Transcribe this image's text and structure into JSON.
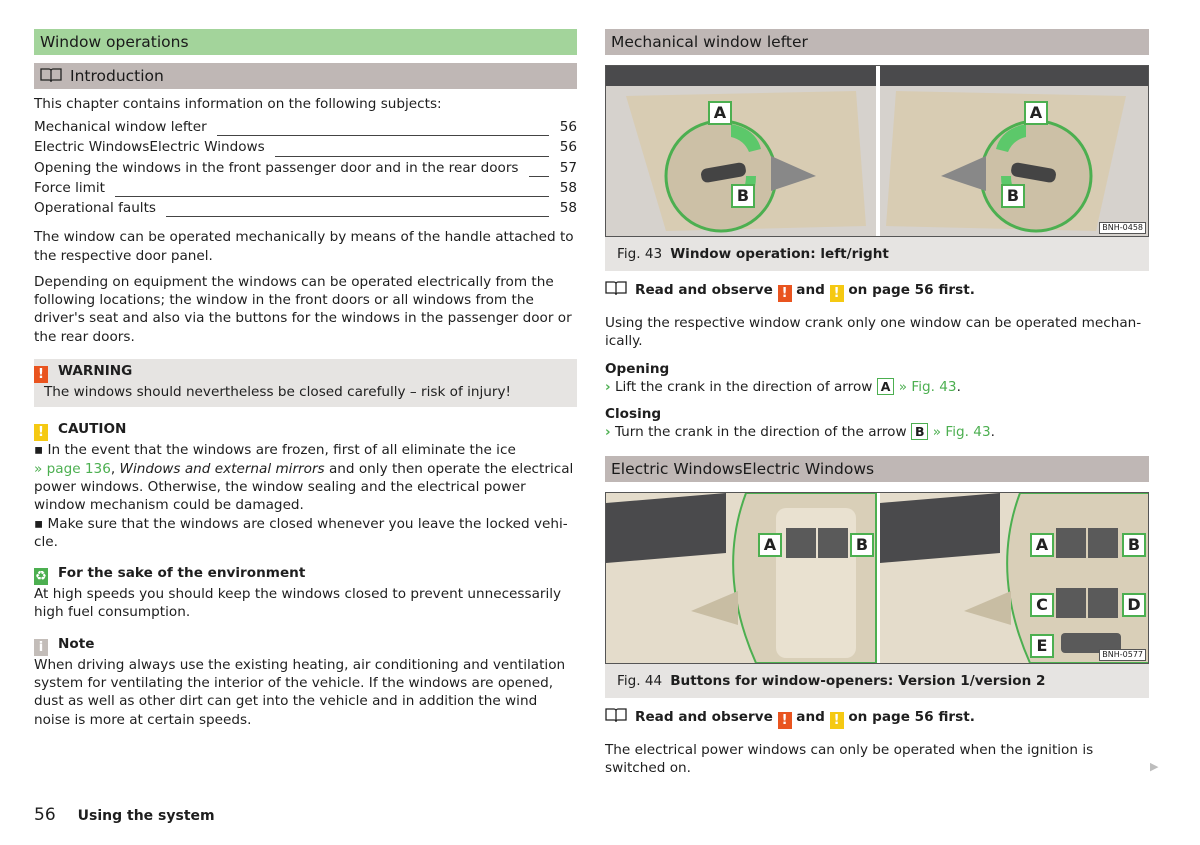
{
  "left": {
    "section_title": "Window operations",
    "intro_title": "Introduction",
    "intro_text": "This chapter contains information on the following subjects:",
    "toc": [
      {
        "title": "Mechanical window lefter",
        "page": "56"
      },
      {
        "title": "Electric WindowsElectric Windows",
        "page": "56"
      },
      {
        "title": "Opening the windows in the front passenger door and in the rear doors",
        "page": "57"
      },
      {
        "title": "Force limit",
        "page": "58"
      },
      {
        "title": "Operational faults",
        "page": "58"
      }
    ],
    "para1": "The window can be operated mechanically by means of the handle attached to the respective door panel.",
    "para2": "Depending on equipment the windows can be operated electrically from the following locations; the window in the front doors or all windows from the driver's seat and also via the buttons for the windows in the passenger door or the rear doors.",
    "warning": {
      "icon": "!",
      "title": "WARNING",
      "text": "The windows should nevertheless be closed carefully – risk of injury!"
    },
    "caution": {
      "icon": "!",
      "title": "CAUTION",
      "bullet1_a": "In the event that the windows are frozen, first of all eliminate the ice",
      "bullet1_link": "» page 136",
      "bullet1_italic": "Windows and external mirrors",
      "bullet1_b": "and only then operate the electri­cal power windows. Otherwise, the window sealing and the electrical power window mechanism could be damaged.",
      "bullet2": "Make sure that the windows are closed whenever you leave the locked vehi­cle."
    },
    "environment": {
      "title": "For the sake of the environment",
      "text": "At high speeds you should keep the windows closed to prevent unnecessarily high fuel consumption."
    },
    "note": {
      "icon": "i",
      "title": "Note",
      "text": "When driving always use the existing heating, air conditioning and ventilation system for ventilating the interior of the vehicle. If the windows are opened, dust as well as other dirt can get into the vehicle and in addition the wind noise is more at certain speeds."
    }
  },
  "right": {
    "section1_title": "Mechanical window lefter",
    "fig43": {
      "code": "BNH-0458",
      "num": "Fig. 43",
      "caption": "Window operation: left/right",
      "labels": [
        "A",
        "B",
        "A",
        "B"
      ]
    },
    "read1": {
      "pre": "Read and observe",
      "and": "and",
      "post": "on page 56 first."
    },
    "mech_text": "Using the respective window crank only one window can be operated mechan­ically.",
    "opening_title": "Opening",
    "opening_text": "Lift the crank in the direction of arrow",
    "opening_label": "A",
    "opening_ref": "» Fig. 43",
    "closing_title": "Closing",
    "closing_text": "Turn the crank in the direction of the arrow",
    "closing_label": "B",
    "closing_ref": "» Fig. 43",
    "section2_title": "Electric WindowsElectric Windows",
    "fig44": {
      "code": "BNH-0577",
      "num": "Fig. 44",
      "caption": "Buttons for window-openers: Version 1/version 2",
      "labels": [
        "A",
        "B",
        "A",
        "B",
        "C",
        "D",
        "E"
      ]
    },
    "read2": {
      "pre": "Read and observe",
      "and": "and",
      "post": "on page 56 first."
    },
    "elec_text": "The electrical power windows can only be operated when the ignition is switched on."
  },
  "footer": {
    "page": "56",
    "section": "Using the system"
  },
  "colors": {
    "green_header": "#a3d49b",
    "grey_header": "#bfb7b5",
    "warning": "#e9541f",
    "caution": "#f5c912",
    "accent": "#4caf50"
  }
}
